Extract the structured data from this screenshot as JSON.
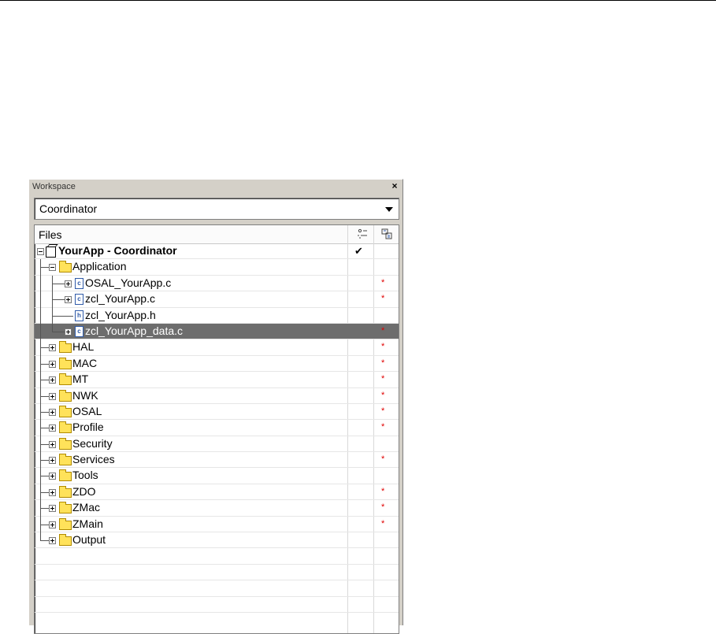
{
  "panel": {
    "title": "Workspace",
    "close_glyph": "×",
    "config_select": {
      "selected": "Coordinator"
    }
  },
  "tree": {
    "columns": {
      "files": "Files",
      "col2_icon": "options-icon",
      "col3_icon": "build-status-icon"
    },
    "rows": [
      {
        "label": "YourApp - Coordinator",
        "type": "project",
        "level": 0,
        "expander": "minus",
        "bold": true,
        "check": "✔",
        "star": ""
      },
      {
        "label": "Application",
        "type": "folder",
        "level": 1,
        "expander": "minus",
        "star": ""
      },
      {
        "label": "OSAL_YourApp.c",
        "type": "c-file",
        "level": 2,
        "expander": "plus",
        "star": "*"
      },
      {
        "label": "zcl_YourApp.c",
        "type": "c-file",
        "level": 2,
        "expander": "plus",
        "star": "*"
      },
      {
        "label": "zcl_YourApp.h",
        "type": "h-file",
        "level": 2,
        "expander": "none",
        "star": ""
      },
      {
        "label": "zcl_YourApp_data.c",
        "type": "c-file",
        "level": 2,
        "expander": "plus",
        "star": "*",
        "selected": true,
        "last": true
      },
      {
        "label": "HAL",
        "type": "folder",
        "level": 1,
        "expander": "plus",
        "star": "*"
      },
      {
        "label": "MAC",
        "type": "folder",
        "level": 1,
        "expander": "plus",
        "star": "*"
      },
      {
        "label": "MT",
        "type": "folder",
        "level": 1,
        "expander": "plus",
        "star": "*"
      },
      {
        "label": "NWK",
        "type": "folder",
        "level": 1,
        "expander": "plus",
        "star": "*"
      },
      {
        "label": "OSAL",
        "type": "folder",
        "level": 1,
        "expander": "plus",
        "star": "*"
      },
      {
        "label": "Profile",
        "type": "folder",
        "level": 1,
        "expander": "plus",
        "star": "*"
      },
      {
        "label": "Security",
        "type": "folder",
        "level": 1,
        "expander": "plus",
        "star": ""
      },
      {
        "label": "Services",
        "type": "folder",
        "level": 1,
        "expander": "plus",
        "star": "*"
      },
      {
        "label": "Tools",
        "type": "folder",
        "level": 1,
        "expander": "plus",
        "star": ""
      },
      {
        "label": "ZDO",
        "type": "folder",
        "level": 1,
        "expander": "plus",
        "star": "*"
      },
      {
        "label": "ZMac",
        "type": "folder",
        "level": 1,
        "expander": "plus",
        "star": "*"
      },
      {
        "label": "ZMain",
        "type": "folder",
        "level": 1,
        "expander": "plus",
        "star": "*"
      },
      {
        "label": "Output",
        "type": "folder",
        "level": 1,
        "expander": "plus",
        "star": "",
        "last": true
      }
    ]
  },
  "colors": {
    "selected_row": "#6d6d6d",
    "folder": "#ffe25a",
    "star": "#e00000",
    "file_icon": "#2f5aa8"
  }
}
